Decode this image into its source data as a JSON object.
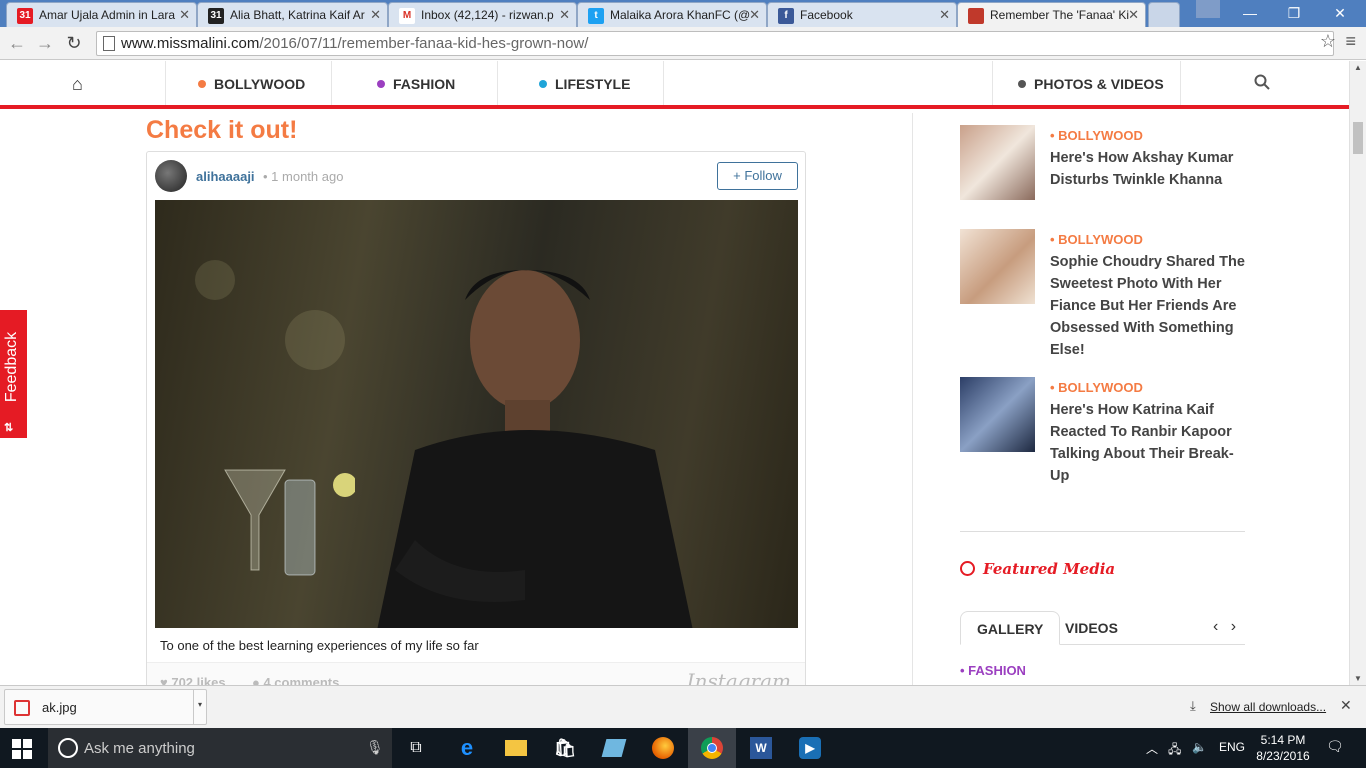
{
  "browser": {
    "tabs": [
      {
        "title": "Amar Ujala Admin in Lara",
        "favicon": "31",
        "favicon_color": "#e51b24"
      },
      {
        "title": "Alia Bhatt, Katrina Kaif Ar",
        "favicon": "31",
        "favicon_color": "#222222"
      },
      {
        "title": "Inbox (42,124) - rizwan.p",
        "favicon": "M",
        "favicon_color": "#d93025"
      },
      {
        "title": "Malaika Arora KhanFC (@",
        "favicon": "t",
        "favicon_color": "#1da1f2"
      },
      {
        "title": "Facebook",
        "favicon": "f",
        "favicon_color": "#3b5998"
      },
      {
        "title": "Remember The 'Fanaa' Ki",
        "favicon": "",
        "favicon_color": "#c0392b"
      }
    ],
    "url_host": "www.missmalini.com",
    "url_path": "/2016/07/11/remember-fanaa-kid-hes-grown-now/",
    "minimize": "—",
    "maximize": "❐",
    "close": "✕"
  },
  "sitenav": {
    "items": [
      {
        "label": "BOLLYWOOD",
        "color": "#f47b43"
      },
      {
        "label": "FASHION",
        "color": "#9b3fc0"
      },
      {
        "label": "LIFESTYLE",
        "color": "#1fa4d8"
      },
      {
        "label": "PHOTOS & VIDEOS",
        "color": "#555555"
      }
    ]
  },
  "article": {
    "section_title": "Check it out!",
    "instagram": {
      "username": "alihaaaaji",
      "time_ago": "1 month ago",
      "follow_label": "+ Follow",
      "caption": "To one of the best learning experiences of my life so far",
      "likes": "702 likes",
      "comments": "4 comments",
      "brand": "Instagram"
    }
  },
  "sidebar": {
    "stories": [
      {
        "category": "• BOLLYWOOD",
        "headline": "Here's How Akshay Kumar Disturbs Twinkle Khanna"
      },
      {
        "category": "• BOLLYWOOD",
        "headline": "Sophie Choudry Shared The Sweetest Photo With Her Fiance But Her Friends Are Obsessed With Something Else!"
      },
      {
        "category": "• BOLLYWOOD",
        "headline": "Here's How Katrina Kaif Reacted To Ranbir Kapoor Talking About Their Break-Up"
      }
    ],
    "featured_title": "Featured Media",
    "media_tabs": [
      "GALLERY",
      "VIDEOS"
    ],
    "arrows": "‹ ›",
    "fashion_label": "• FASHION"
  },
  "feedback": {
    "label": "Feedback",
    "icon": "⇅"
  },
  "downloads": {
    "file": "ak.jpg",
    "show_all": "Show all downloads..."
  },
  "taskbar": {
    "search_placeholder": "Ask me anything",
    "language": "ENG",
    "time": "5:14 PM",
    "date": "8/23/2016"
  }
}
